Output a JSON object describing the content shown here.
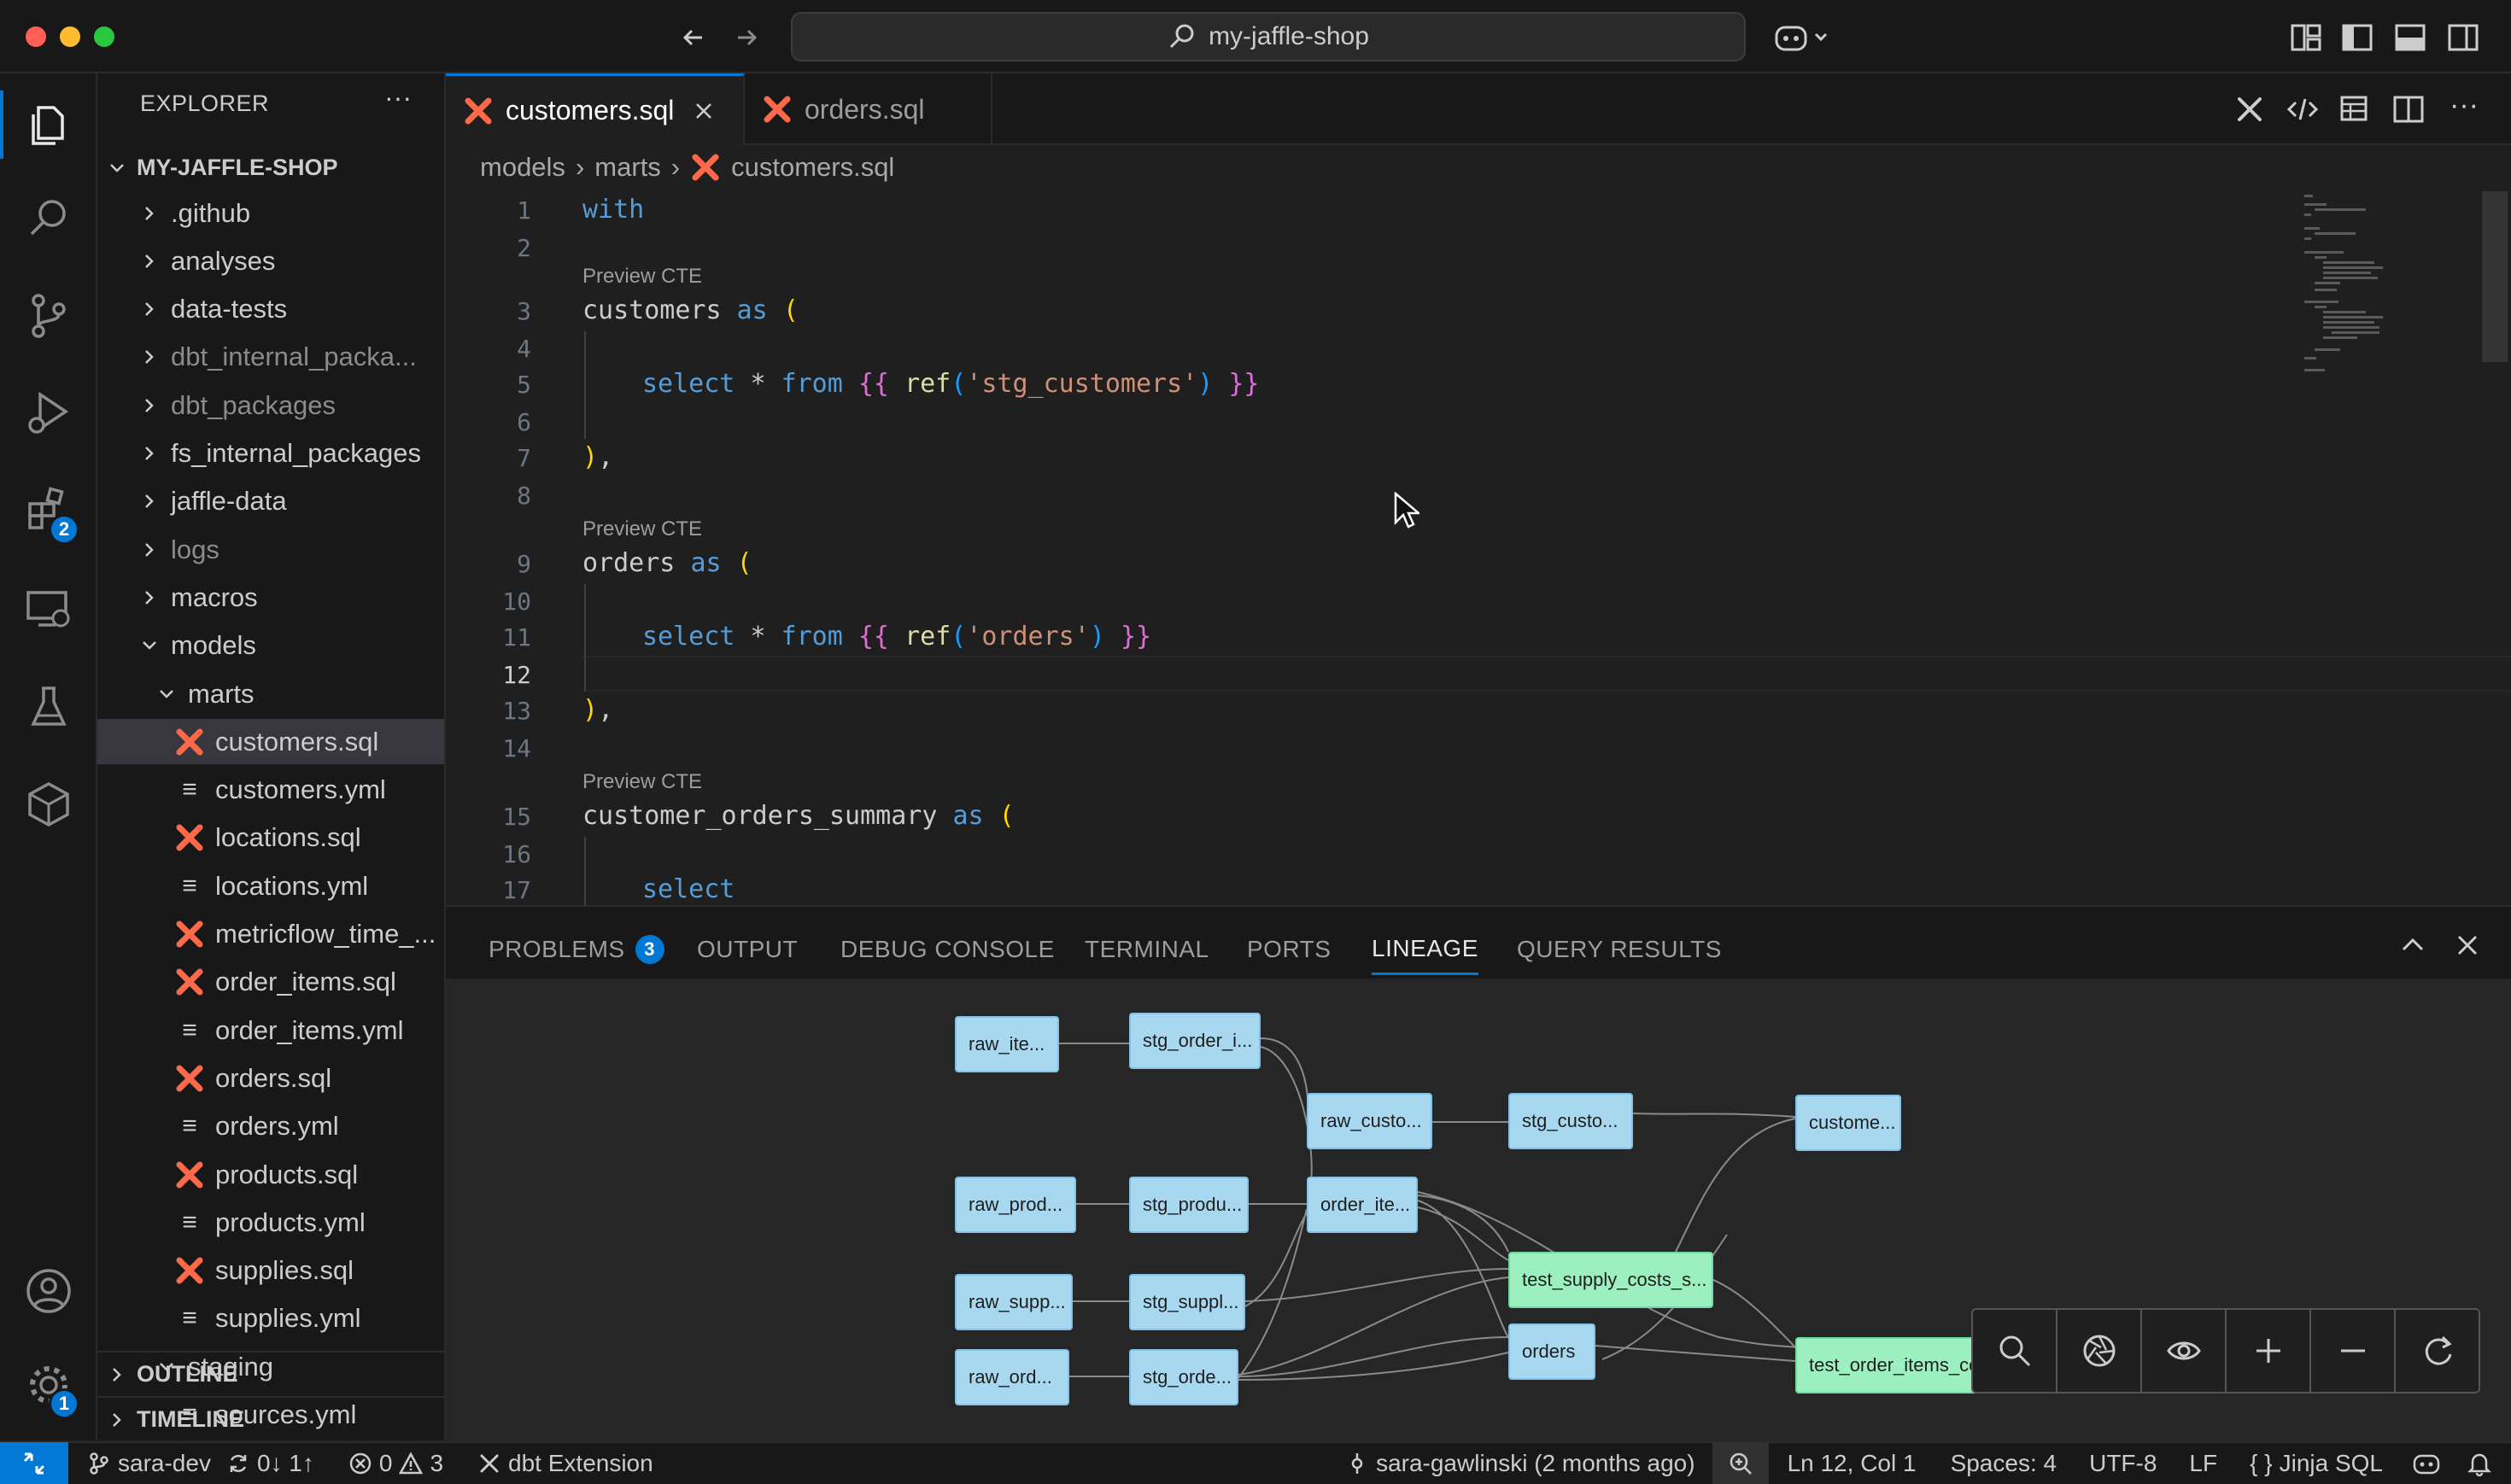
{
  "window": {
    "title": "my-jaffle-shop"
  },
  "explorer": {
    "title": "EXPLORER",
    "root": "MY-JAFFLE-SHOP",
    "items": [
      {
        "label": ".github",
        "type": "folder",
        "dim": false
      },
      {
        "label": "analyses",
        "type": "folder",
        "dim": false
      },
      {
        "label": "data-tests",
        "type": "folder",
        "dim": false
      },
      {
        "label": "dbt_internal_packa...",
        "type": "folder",
        "dim": true
      },
      {
        "label": "dbt_packages",
        "type": "folder",
        "dim": true
      },
      {
        "label": "fs_internal_packages",
        "type": "folder",
        "dim": false
      },
      {
        "label": "jaffle-data",
        "type": "folder",
        "dim": false
      },
      {
        "label": "logs",
        "type": "folder",
        "dim": true
      },
      {
        "label": "macros",
        "type": "folder",
        "dim": false
      },
      {
        "label": "models",
        "type": "folder-open",
        "dim": false
      },
      {
        "label": "marts",
        "type": "folder-open",
        "dim": false
      },
      {
        "label": "customers.sql",
        "type": "sql",
        "dim": false
      },
      {
        "label": "customers.yml",
        "type": "yml",
        "dim": false
      },
      {
        "label": "locations.sql",
        "type": "sql",
        "dim": false
      },
      {
        "label": "locations.yml",
        "type": "yml",
        "dim": false
      },
      {
        "label": "metricflow_time_...",
        "type": "sql",
        "dim": false
      },
      {
        "label": "order_items.sql",
        "type": "sql",
        "dim": false
      },
      {
        "label": "order_items.yml",
        "type": "yml",
        "dim": false
      },
      {
        "label": "orders.sql",
        "type": "sql",
        "dim": false
      },
      {
        "label": "orders.yml",
        "type": "yml",
        "dim": false
      },
      {
        "label": "products.sql",
        "type": "sql",
        "dim": false
      },
      {
        "label": "products.yml",
        "type": "yml",
        "dim": false
      },
      {
        "label": "supplies.sql",
        "type": "sql",
        "dim": false
      },
      {
        "label": "supplies.yml",
        "type": "yml",
        "dim": false
      },
      {
        "label": "staging",
        "type": "folder-open",
        "dim": false
      },
      {
        "label": "sources.yml",
        "type": "yml",
        "dim": false
      }
    ],
    "outline": "OUTLINE",
    "timeline": "TIMELINE"
  },
  "activity": {
    "extensions_badge": "2",
    "settings_badge": "1"
  },
  "tabs": [
    {
      "label": "customers.sql"
    },
    {
      "label": "orders.sql"
    }
  ],
  "breadcrumb": [
    "models",
    "marts",
    "customers.sql"
  ],
  "editor": {
    "codelens": "Preview CTE",
    "line_numbers": [
      "1",
      "2",
      "3",
      "4",
      "5",
      "6",
      "7",
      "8",
      "9",
      "10",
      "11",
      "12",
      "13",
      "14",
      "15",
      "16",
      "17"
    ],
    "lines": {
      "l1": "with",
      "l3_name": "customers",
      "l5_fn": "ref",
      "l5_arg": "'stg_customers'",
      "l9_name": "orders",
      "l11_arg": "'orders'",
      "l15_name": "customer_orders_summary",
      "kw_as": "as",
      "kw_select": "select",
      "kw_from": "from",
      "star": "*"
    }
  },
  "panel": {
    "tabs": [
      "PROBLEMS",
      "OUTPUT",
      "DEBUG CONSOLE",
      "TERMINAL",
      "PORTS",
      "LINEAGE",
      "QUERY RESULTS"
    ],
    "problems_count": "3",
    "active_tab": "LINEAGE"
  },
  "lineage": {
    "nodes": [
      {
        "id": "n1",
        "label": "raw_ite..."
      },
      {
        "id": "n2",
        "label": "stg_order_i..."
      },
      {
        "id": "n3",
        "label": "raw_custo..."
      },
      {
        "id": "n4",
        "label": "stg_custo..."
      },
      {
        "id": "n5",
        "label": "custome..."
      },
      {
        "id": "n6",
        "label": "raw_prod..."
      },
      {
        "id": "n7",
        "label": "stg_produ..."
      },
      {
        "id": "n8",
        "label": "order_ite..."
      },
      {
        "id": "n9",
        "label": "test_supply_costs_s..."
      },
      {
        "id": "n10",
        "label": "raw_supp..."
      },
      {
        "id": "n11",
        "label": "stg_suppl..."
      },
      {
        "id": "n12",
        "label": "orders"
      },
      {
        "id": "n13",
        "label": "raw_ord..."
      },
      {
        "id": "n14",
        "label": "stg_orde..."
      },
      {
        "id": "n15",
        "label": "test_order_items_compu"
      }
    ]
  },
  "statusbar": {
    "branch": "sara-dev",
    "sync": "0↓ 1↑",
    "errors": "0",
    "warnings": "3",
    "dbt": "dbt Extension",
    "blame": "sara-gawlinski (2 months ago)",
    "position": "Ln 12, Col 1",
    "spaces": "Spaces: 4",
    "encoding": "UTF-8",
    "eol": "LF",
    "language": "Jinja SQL"
  },
  "colors": {
    "accent": "#0078d4",
    "dbt_orange": "#ff694a",
    "node_blue": "#a8d8f0",
    "node_green": "#9cf0c0"
  }
}
